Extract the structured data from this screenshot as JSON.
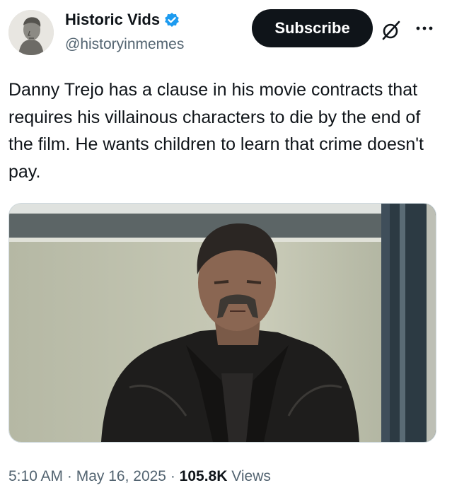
{
  "author": {
    "display_name": "Historic Vids",
    "handle": "@historyinmemes",
    "verified": true,
    "avatar_icon": "bust-portrait-avatar"
  },
  "actions": {
    "subscribe_label": "Subscribe",
    "grok_icon": "grok-icon",
    "more_icon": "more-options-icon"
  },
  "tweet": {
    "text": "Danny Trejo has a clause in his movie contracts that requires his villainous characters to die by the end of the film. He wants children to learn that crime doesn't pay.",
    "media_icon": "photo-man-in-leather-jacket"
  },
  "meta": {
    "time": "5:10 AM",
    "sep1": " · ",
    "date": "May 16, 2025",
    "sep2": " · ",
    "views_count": "105.8K",
    "views_label": " Views"
  },
  "colors": {
    "text": "#0f1419",
    "secondary": "#536471",
    "verified_blue": "#1d9bf0",
    "button_bg": "#0f1419"
  }
}
